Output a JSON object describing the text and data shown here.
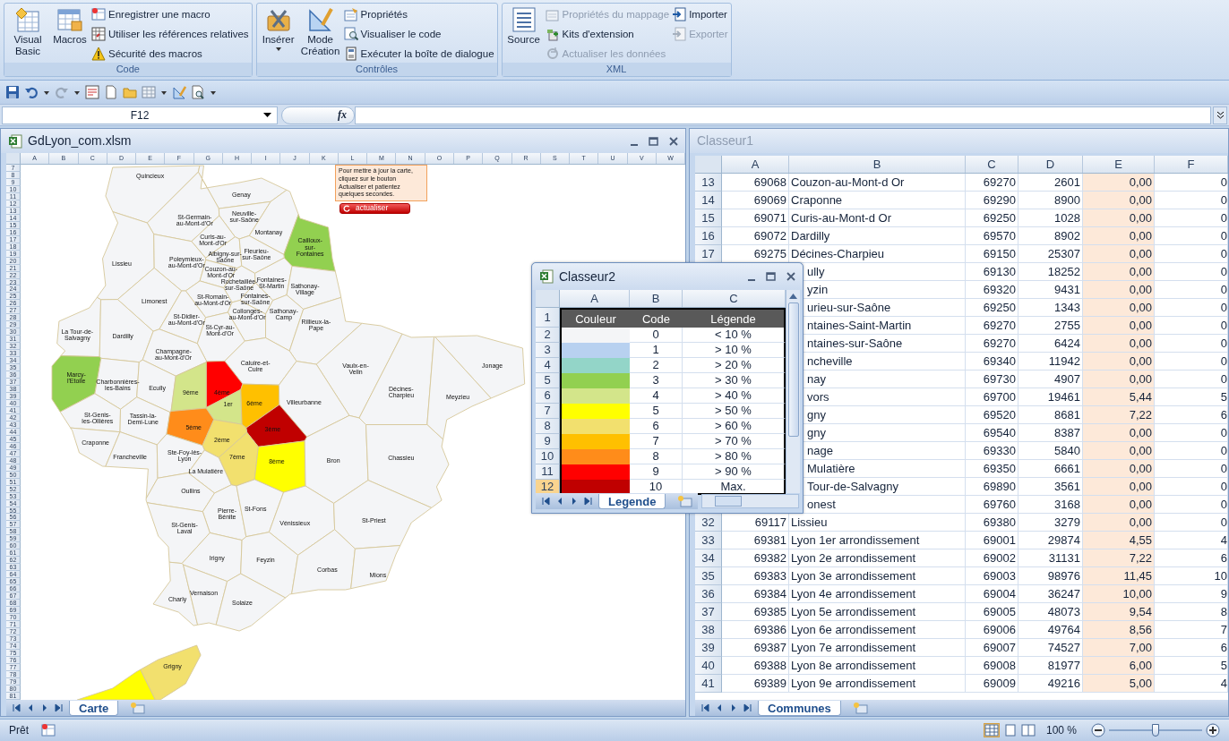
{
  "ribbon": {
    "groups": [
      {
        "label": "Code",
        "items": [
          {
            "kind": "large",
            "label": "Visual Basic",
            "disabled": false,
            "dropdown": false
          },
          {
            "kind": "large",
            "label": "Macros",
            "disabled": false,
            "dropdown": false
          },
          {
            "kind": "small",
            "label": "Enregistrer une macro",
            "disabled": false,
            "dropdown": false
          },
          {
            "kind": "small",
            "label": "Utiliser les références relatives",
            "disabled": false,
            "dropdown": false
          },
          {
            "kind": "small",
            "label": "Sécurité des macros",
            "disabled": false,
            "dropdown": false
          }
        ]
      },
      {
        "label": "Contrôles",
        "items": [
          {
            "kind": "large",
            "label": "Insérer",
            "disabled": false,
            "dropdown": true
          },
          {
            "kind": "large",
            "label": "Mode Création",
            "disabled": false,
            "dropdown": false
          },
          {
            "kind": "small",
            "label": "Propriétés",
            "disabled": false,
            "dropdown": false
          },
          {
            "kind": "small",
            "label": "Visualiser le code",
            "disabled": false,
            "dropdown": false
          },
          {
            "kind": "small",
            "label": "Exécuter la boîte de dialogue",
            "disabled": false,
            "dropdown": false
          }
        ]
      },
      {
        "label": "XML",
        "items": [
          {
            "kind": "large",
            "label": "Source",
            "disabled": false,
            "dropdown": false
          },
          {
            "kind": "small",
            "label": "Propriétés du mappage",
            "disabled": true,
            "dropdown": false
          },
          {
            "kind": "small",
            "label": "Kits d'extension",
            "disabled": false,
            "dropdown": false
          },
          {
            "kind": "small",
            "label": "Actualiser les données",
            "disabled": true,
            "dropdown": false
          },
          {
            "kind": "small",
            "label": "Importer",
            "disabled": false,
            "dropdown": false
          },
          {
            "kind": "small",
            "label": "Exporter",
            "disabled": true,
            "dropdown": false
          }
        ]
      }
    ]
  },
  "formula_bar": {
    "name_box": "F12",
    "function_button": "fx"
  },
  "map_window": {
    "title": "GdLyon_com.xlsm",
    "columns": [
      "A",
      "B",
      "C",
      "D",
      "E",
      "F",
      "G",
      "H",
      "I",
      "J",
      "K",
      "L",
      "M",
      "N",
      "O",
      "P",
      "Q",
      "R",
      "S",
      "T",
      "U",
      "V",
      "W"
    ],
    "rows": [
      "7",
      "8",
      "9",
      "10",
      "11",
      "12",
      "13",
      "14",
      "15",
      "16",
      "17",
      "18",
      "19",
      "20",
      "21",
      "22",
      "23",
      "24",
      "25",
      "26",
      "27",
      "28",
      "29",
      "30",
      "31",
      "32",
      "33",
      "34",
      "35",
      "36",
      "37",
      "38",
      "39",
      "40",
      "41",
      "42",
      "43",
      "44",
      "45",
      "46",
      "47",
      "48",
      "49",
      "50",
      "51",
      "52",
      "53",
      "54",
      "55",
      "56",
      "57",
      "58",
      "59",
      "60",
      "61",
      "62",
      "63",
      "64",
      "65",
      "66",
      "67",
      "68",
      "69",
      "70",
      "71",
      "72",
      "73",
      "74",
      "75",
      "76",
      "77",
      "78",
      "79",
      "80",
      "81"
    ],
    "note": "Pour mettre à jour la carte, cliquez sur le bouton Actualiser et patientez quelques secondes.",
    "button": "actualiser",
    "map": {
      "communes": [
        {
          "name": "Quincieux",
          "color": "#f4f5f7"
        },
        {
          "name": "Genay",
          "color": "#f4f5f7"
        },
        {
          "name": "St-Germain-au-Mont-d'Or",
          "color": "#f4f5f7"
        },
        {
          "name": "Neuville-sur-Saône",
          "color": "#f4f5f7"
        },
        {
          "name": "Montanay",
          "color": "#f4f5f7"
        },
        {
          "name": "Curis-au-Mont-d'Or",
          "color": "#f4f5f7"
        },
        {
          "name": "Cailloux-sur-Fontaines",
          "color": "#92d050"
        },
        {
          "name": "Lissieu",
          "color": "#f4f5f7"
        },
        {
          "name": "Poleymieux-au-Mont-d'Or",
          "color": "#f4f5f7"
        },
        {
          "name": "Albigny-sur-Saône",
          "color": "#f4f5f7"
        },
        {
          "name": "Fleurieu-sur-Saône",
          "color": "#f4f5f7"
        },
        {
          "name": "Couzon-au-Mont-d'Or",
          "color": "#f4f5f7"
        },
        {
          "name": "Rochetaillée-sur-Saône",
          "color": "#f4f5f7"
        },
        {
          "name": "Fontaines-St-Martin",
          "color": "#f4f5f7"
        },
        {
          "name": "Sathonay-Village",
          "color": "#f4f5f7"
        },
        {
          "name": "Limonest",
          "color": "#f4f5f7"
        },
        {
          "name": "St-Romain-au-Mont-d'Or",
          "color": "#f4f5f7"
        },
        {
          "name": "Fontaines-sur-Saône",
          "color": "#f4f5f7"
        },
        {
          "name": "St-Didier-au-Mont-d'Or",
          "color": "#f4f5f7"
        },
        {
          "name": "Collonges-au-Mont-d'Or",
          "color": "#f4f5f7"
        },
        {
          "name": "Sathonay-Camp",
          "color": "#f4f5f7"
        },
        {
          "name": "St-Cyr-au-Mont-d'Or",
          "color": "#f4f5f7"
        },
        {
          "name": "Rillieux-la-Pape",
          "color": "#f4f5f7"
        },
        {
          "name": "La Tour-de-Salvagny",
          "color": "#f4f5f7"
        },
        {
          "name": "Dardilly",
          "color": "#f4f5f7"
        },
        {
          "name": "Champagne-au-Mont-d'Or",
          "color": "#f4f5f7"
        },
        {
          "name": "Caluire-et-Cuire",
          "color": "#f4f5f7"
        },
        {
          "name": "Vaulx-en-Velin",
          "color": "#f4f5f7"
        },
        {
          "name": "Jonage",
          "color": "#f4f5f7"
        },
        {
          "name": "Marcy-l'Etoile",
          "color": "#92d050"
        },
        {
          "name": "Charbonnières-les-Bains",
          "color": "#f4f5f7"
        },
        {
          "name": "Ecully",
          "color": "#f4f5f7"
        },
        {
          "name": "9ème",
          "color": "#d3e58a"
        },
        {
          "name": "4ème",
          "color": "#ff0000"
        },
        {
          "name": "Décines-Charpieu",
          "color": "#f4f5f7"
        },
        {
          "name": "1er",
          "color": "#d3e58a"
        },
        {
          "name": "6ème",
          "color": "#ffc000"
        },
        {
          "name": "Villeurbanne",
          "color": "#f4f5f7"
        },
        {
          "name": "Meyzieu",
          "color": "#f4f5f7"
        },
        {
          "name": "St-Genis-les-Ollières",
          "color": "#f4f5f7"
        },
        {
          "name": "Tassin-la-Demi-Lune",
          "color": "#f4f5f7"
        },
        {
          "name": "5ème",
          "color": "#ff8c1a"
        },
        {
          "name": "3ème",
          "color": "#c00000"
        },
        {
          "name": "Craponne",
          "color": "#f4f5f7"
        },
        {
          "name": "2ème",
          "color": "#f2e06e"
        },
        {
          "name": "Francheville",
          "color": "#f4f5f7"
        },
        {
          "name": "Ste-Foy-lès-Lyon",
          "color": "#f4f5f7"
        },
        {
          "name": "7ème",
          "color": "#f2e06e"
        },
        {
          "name": "8ème",
          "color": "#ffff00"
        },
        {
          "name": "Bron",
          "color": "#f4f5f7"
        },
        {
          "name": "Chassieu",
          "color": "#f4f5f7"
        },
        {
          "name": "La Mulatière",
          "color": "#f4f5f7"
        },
        {
          "name": "Oullins",
          "color": "#f4f5f7"
        },
        {
          "name": "Pierre-Bénite",
          "color": "#f4f5f7"
        },
        {
          "name": "St-Fons",
          "color": "#f4f5f7"
        },
        {
          "name": "St-Genis-Laval",
          "color": "#f4f5f7"
        },
        {
          "name": "Vénissieux",
          "color": "#f4f5f7"
        },
        {
          "name": "St-Priest",
          "color": "#f4f5f7"
        },
        {
          "name": "Irigny",
          "color": "#f4f5f7"
        },
        {
          "name": "Feyzin",
          "color": "#f4f5f7"
        },
        {
          "name": "Corbas",
          "color": "#f4f5f7"
        },
        {
          "name": "Mions",
          "color": "#f4f5f7"
        },
        {
          "name": "Charly",
          "color": "#f4f5f7"
        },
        {
          "name": "Vernaison",
          "color": "#f4f5f7"
        },
        {
          "name": "Solaize",
          "color": "#f4f5f7"
        },
        {
          "name": "Grigny",
          "color": "#f2e06e"
        },
        {
          "color": "#ffff00"
        }
      ]
    },
    "sheet_tabs": [
      {
        "label": "Carte",
        "selected": true
      }
    ]
  },
  "data_window": {
    "title": "Classeur1",
    "columns": [
      "A",
      "B",
      "C",
      "D",
      "E",
      "F"
    ],
    "rows": [
      {
        "n": "13",
        "a": "69068",
        "b": "Couzon-au-Mont-d Or",
        "c": "69270",
        "d": "2601",
        "e": "0,00",
        "f": "0"
      },
      {
        "n": "14",
        "a": "69069",
        "b": "Craponne",
        "c": "69290",
        "d": "8900",
        "e": "0,00",
        "f": "0"
      },
      {
        "n": "15",
        "a": "69071",
        "b": "Curis-au-Mont-d Or",
        "c": "69250",
        "d": "1028",
        "e": "0,00",
        "f": "0"
      },
      {
        "n": "16",
        "a": "69072",
        "b": "Dardilly",
        "c": "69570",
        "d": "8902",
        "e": "0,00",
        "f": "0"
      },
      {
        "n": "17",
        "a": "69275",
        "b": "Décines-Charpieu",
        "c": "69150",
        "d": "25307",
        "e": "0,00",
        "f": "0"
      },
      {
        "b": "ully",
        "c": "69130",
        "d": "18252",
        "e": "0,00",
        "f": "0"
      },
      {
        "b": "yzin",
        "c": "69320",
        "d": "9431",
        "e": "0,00",
        "f": "0"
      },
      {
        "b": "urieu-sur-Saône",
        "c": "69250",
        "d": "1343",
        "e": "0,00",
        "f": "0"
      },
      {
        "b": "ntaines-Saint-Martin",
        "c": "69270",
        "d": "2755",
        "e": "0,00",
        "f": "0"
      },
      {
        "b": "ntaines-sur-Saône",
        "c": "69270",
        "d": "6424",
        "e": "0,00",
        "f": "0"
      },
      {
        "b": "ncheville",
        "c": "69340",
        "d": "11942",
        "e": "0,00",
        "f": "0"
      },
      {
        "b": "nay",
        "c": "69730",
        "d": "4907",
        "e": "0,00",
        "f": "0"
      },
      {
        "b": "vors",
        "c": "69700",
        "d": "19461",
        "e": "5,44",
        "f": "5"
      },
      {
        "b": "gny",
        "c": "69520",
        "d": "8681",
        "e": "7,22",
        "f": "6"
      },
      {
        "b": "gny",
        "c": "69540",
        "d": "8387",
        "e": "0,00",
        "f": "0"
      },
      {
        "b": "nage",
        "c": "69330",
        "d": "5840",
        "e": "0,00",
        "f": "0"
      },
      {
        "b": "Mulatière",
        "c": "69350",
        "d": "6661",
        "e": "0,00",
        "f": "0"
      },
      {
        "b": "Tour-de-Salvagny",
        "c": "69890",
        "d": "3561",
        "e": "0,00",
        "f": "0"
      },
      {
        "b": "onest",
        "c": "69760",
        "d": "3168",
        "e": "0,00",
        "f": "0"
      },
      {
        "n": "32",
        "a": "69117",
        "b": "Lissieu",
        "c": "69380",
        "d": "3279",
        "e": "0,00",
        "f": "0"
      },
      {
        "n": "33",
        "a": "69381",
        "b": "Lyon 1er arrondissement",
        "c": "69001",
        "d": "29874",
        "e": "4,55",
        "f": "4"
      },
      {
        "n": "34",
        "a": "69382",
        "b": "Lyon 2e arrondissement",
        "c": "69002",
        "d": "31131",
        "e": "7,22",
        "f": "6"
      },
      {
        "n": "35",
        "a": "69383",
        "b": "Lyon 3e arrondissement",
        "c": "69003",
        "d": "98976",
        "e": "11,45",
        "f": "10"
      },
      {
        "n": "36",
        "a": "69384",
        "b": "Lyon 4e arrondissement",
        "c": "69004",
        "d": "36247",
        "e": "10,00",
        "f": "9"
      },
      {
        "n": "37",
        "a": "69385",
        "b": "Lyon 5e arrondissement",
        "c": "69005",
        "d": "48073",
        "e": "9,54",
        "f": "8"
      },
      {
        "n": "38",
        "a": "69386",
        "b": "Lyon 6e arrondissement",
        "c": "69006",
        "d": "49764",
        "e": "8,56",
        "f": "7"
      },
      {
        "n": "39",
        "a": "69387",
        "b": "Lyon 7e arrondissement",
        "c": "69007",
        "d": "74527",
        "e": "7,00",
        "f": "6"
      },
      {
        "n": "40",
        "a": "69388",
        "b": "Lyon 8e arrondissement",
        "c": "69008",
        "d": "81977",
        "e": "6,00",
        "f": "5"
      },
      {
        "n": "41",
        "a": "69389",
        "b": "Lyon 9e arrondissement",
        "c": "69009",
        "d": "49216",
        "e": "5,00",
        "f": "4"
      }
    ],
    "sheet_tabs": [
      {
        "label": "Communes",
        "selected": true
      }
    ]
  },
  "legend_window": {
    "title": "Classeur2",
    "columns": [
      "A",
      "B",
      "C"
    ],
    "rows": [
      {
        "n": "1",
        "kind": "header",
        "selected": false,
        "cells": [
          "Couleur",
          "Code",
          "Légende"
        ]
      },
      {
        "n": "2",
        "kind": "entry",
        "selected": false,
        "color": "#f4f5f7",
        "code": "0",
        "legend": "< 10 %"
      },
      {
        "n": "3",
        "kind": "entry",
        "selected": false,
        "color": "#b8d1f0",
        "code": "1",
        "legend": "> 10 %"
      },
      {
        "n": "4",
        "kind": "entry",
        "selected": false,
        "color": "#93d5c8",
        "code": "2",
        "legend": "> 20 %"
      },
      {
        "n": "5",
        "kind": "entry",
        "selected": false,
        "color": "#92d050",
        "code": "3",
        "legend": "> 30 %"
      },
      {
        "n": "6",
        "kind": "entry",
        "selected": false,
        "color": "#d3e58a",
        "code": "4",
        "legend": "> 40 %"
      },
      {
        "n": "7",
        "kind": "entry",
        "selected": false,
        "color": "#ffff00",
        "code": "5",
        "legend": "> 50 %"
      },
      {
        "n": "8",
        "kind": "entry",
        "selected": false,
        "color": "#f2e06e",
        "code": "6",
        "legend": "> 60 %"
      },
      {
        "n": "9",
        "kind": "entry",
        "selected": false,
        "color": "#ffc000",
        "code": "7",
        "legend": "> 70 %"
      },
      {
        "n": "10",
        "kind": "entry",
        "selected": false,
        "color": "#ff8c1a",
        "code": "8",
        "legend": "> 80 %"
      },
      {
        "n": "11",
        "kind": "entry",
        "selected": false,
        "color": "#ff0000",
        "code": "9",
        "legend": "> 90 %"
      },
      {
        "n": "12",
        "kind": "entry",
        "selected": true,
        "color": "#c00000",
        "code": "10",
        "legend": "Max."
      }
    ],
    "sheet_tabs": [
      {
        "label": "Legende",
        "selected": true
      }
    ]
  },
  "status_bar": {
    "status": "Prêt",
    "zoom": "100 %",
    "zoom_slider": {
      "level": 0.5
    }
  }
}
